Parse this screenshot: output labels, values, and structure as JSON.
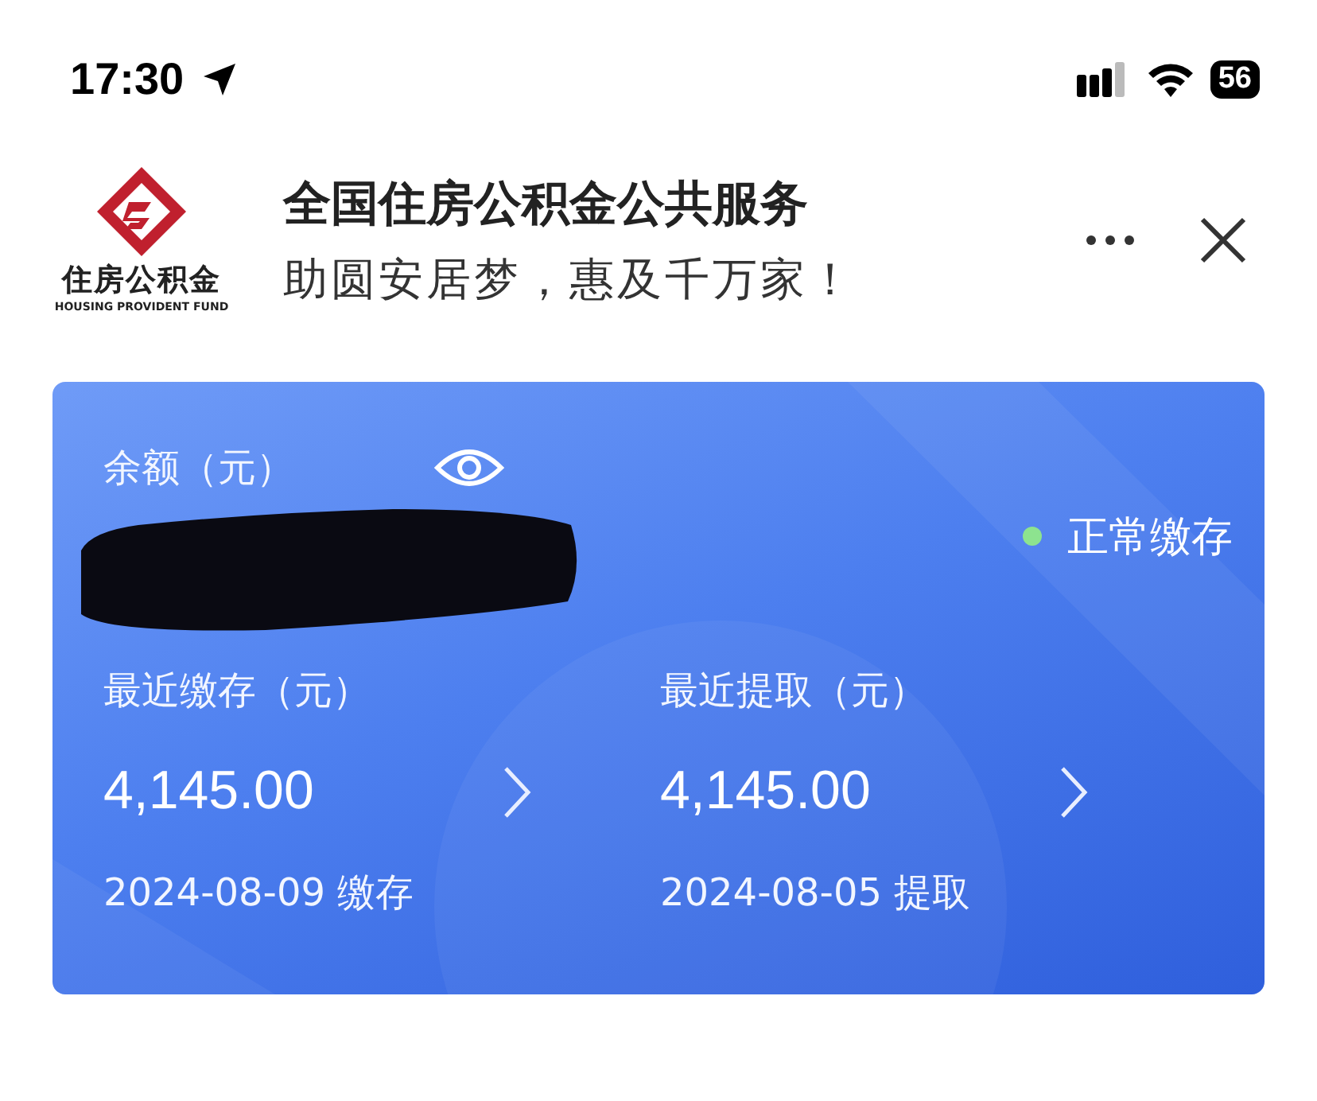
{
  "status_bar": {
    "time": "17:30",
    "battery": "56"
  },
  "header": {
    "logo_name": "住房公积金",
    "logo_subtitle": "HOUSING PROVIDENT FUND",
    "title": "全国住房公积金公共服务",
    "slogan": "助圆安居梦，惠及千万家！"
  },
  "card": {
    "balance_label": "余额（元）",
    "status": "正常缴存",
    "items": [
      {
        "label": "最近缴存（元）",
        "amount": "4,145.00",
        "date": "2024-08-09 缴存"
      },
      {
        "label": "最近提取（元）",
        "amount": "4,145.00",
        "date": "2024-08-05 提取"
      }
    ]
  }
}
